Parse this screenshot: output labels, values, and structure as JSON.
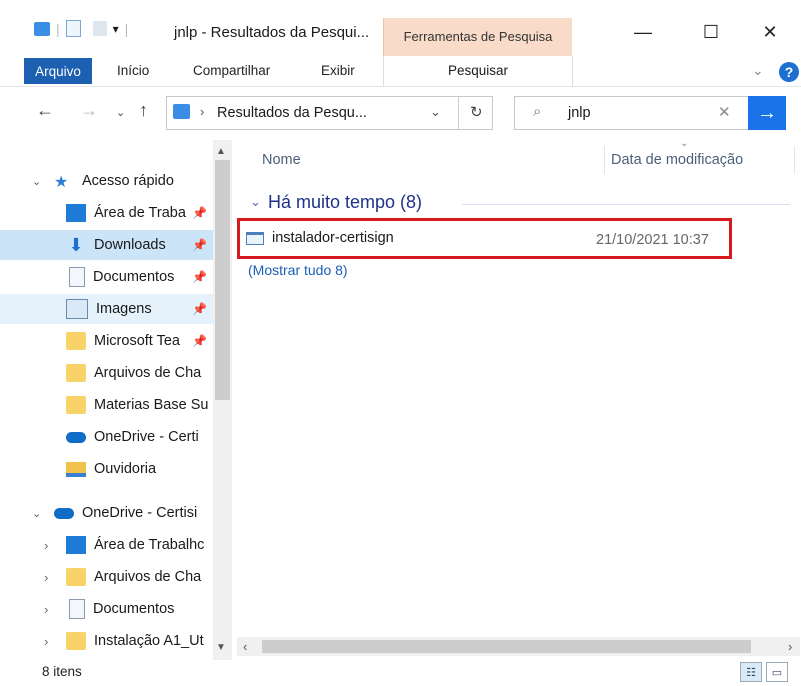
{
  "window": {
    "title": "jnlp - Resultados da Pesqui...",
    "context_tab": "Ferramentas de Pesquisa",
    "minimize": "—",
    "maximize": "☐",
    "close": "✕"
  },
  "ribbon": {
    "tabs": [
      "Arquivo",
      "Início",
      "Compartilhar",
      "Exibir",
      "Pesquisar"
    ],
    "help": "?"
  },
  "nav": {
    "address": "Resultados da Pesqu...",
    "search_value": "jnlp"
  },
  "sidebar": {
    "items": [
      {
        "label": "Acesso rápido",
        "icon": "star-icon"
      },
      {
        "label": "Área de Traba",
        "icon": "desktop-icon",
        "pinned": true
      },
      {
        "label": "Downloads",
        "icon": "download-icon",
        "pinned": true
      },
      {
        "label": "Documentos",
        "icon": "document-icon",
        "pinned": true
      },
      {
        "label": "Imagens",
        "icon": "image-icon",
        "pinned": true
      },
      {
        "label": "Microsoft Tea",
        "icon": "folder-icon",
        "pinned": true
      },
      {
        "label": "Arquivos de Cha",
        "icon": "folder-icon"
      },
      {
        "label": "Materias Base Su",
        "icon": "folder-icon"
      },
      {
        "label": "OneDrive - Certi",
        "icon": "cloud-icon"
      },
      {
        "label": "Ouvidoria",
        "icon": "network-drive-icon"
      },
      {
        "label": "OneDrive - Certisi",
        "icon": "cloud-icon"
      },
      {
        "label": "Área de Trabalhc",
        "icon": "desktop-icon"
      },
      {
        "label": "Arquivos de Cha",
        "icon": "folder-icon"
      },
      {
        "label": "Documentos",
        "icon": "document-icon"
      },
      {
        "label": "Instalação A1_Ut",
        "icon": "folder-icon"
      }
    ]
  },
  "content": {
    "col_name": "Nome",
    "col_date": "Data de modificação",
    "group": "Há muito tempo (8)",
    "file_name": "instalador-certisign",
    "file_date": "21/10/2021 10:37",
    "show_all": "(Mostrar tudo 8)"
  },
  "status": {
    "count": "8 itens"
  },
  "colors": {
    "accent": "#1d5fb1",
    "selected": "#cce4f7",
    "highlight_border": "#d71920",
    "context_tab_bg": "#f8dcc9"
  }
}
